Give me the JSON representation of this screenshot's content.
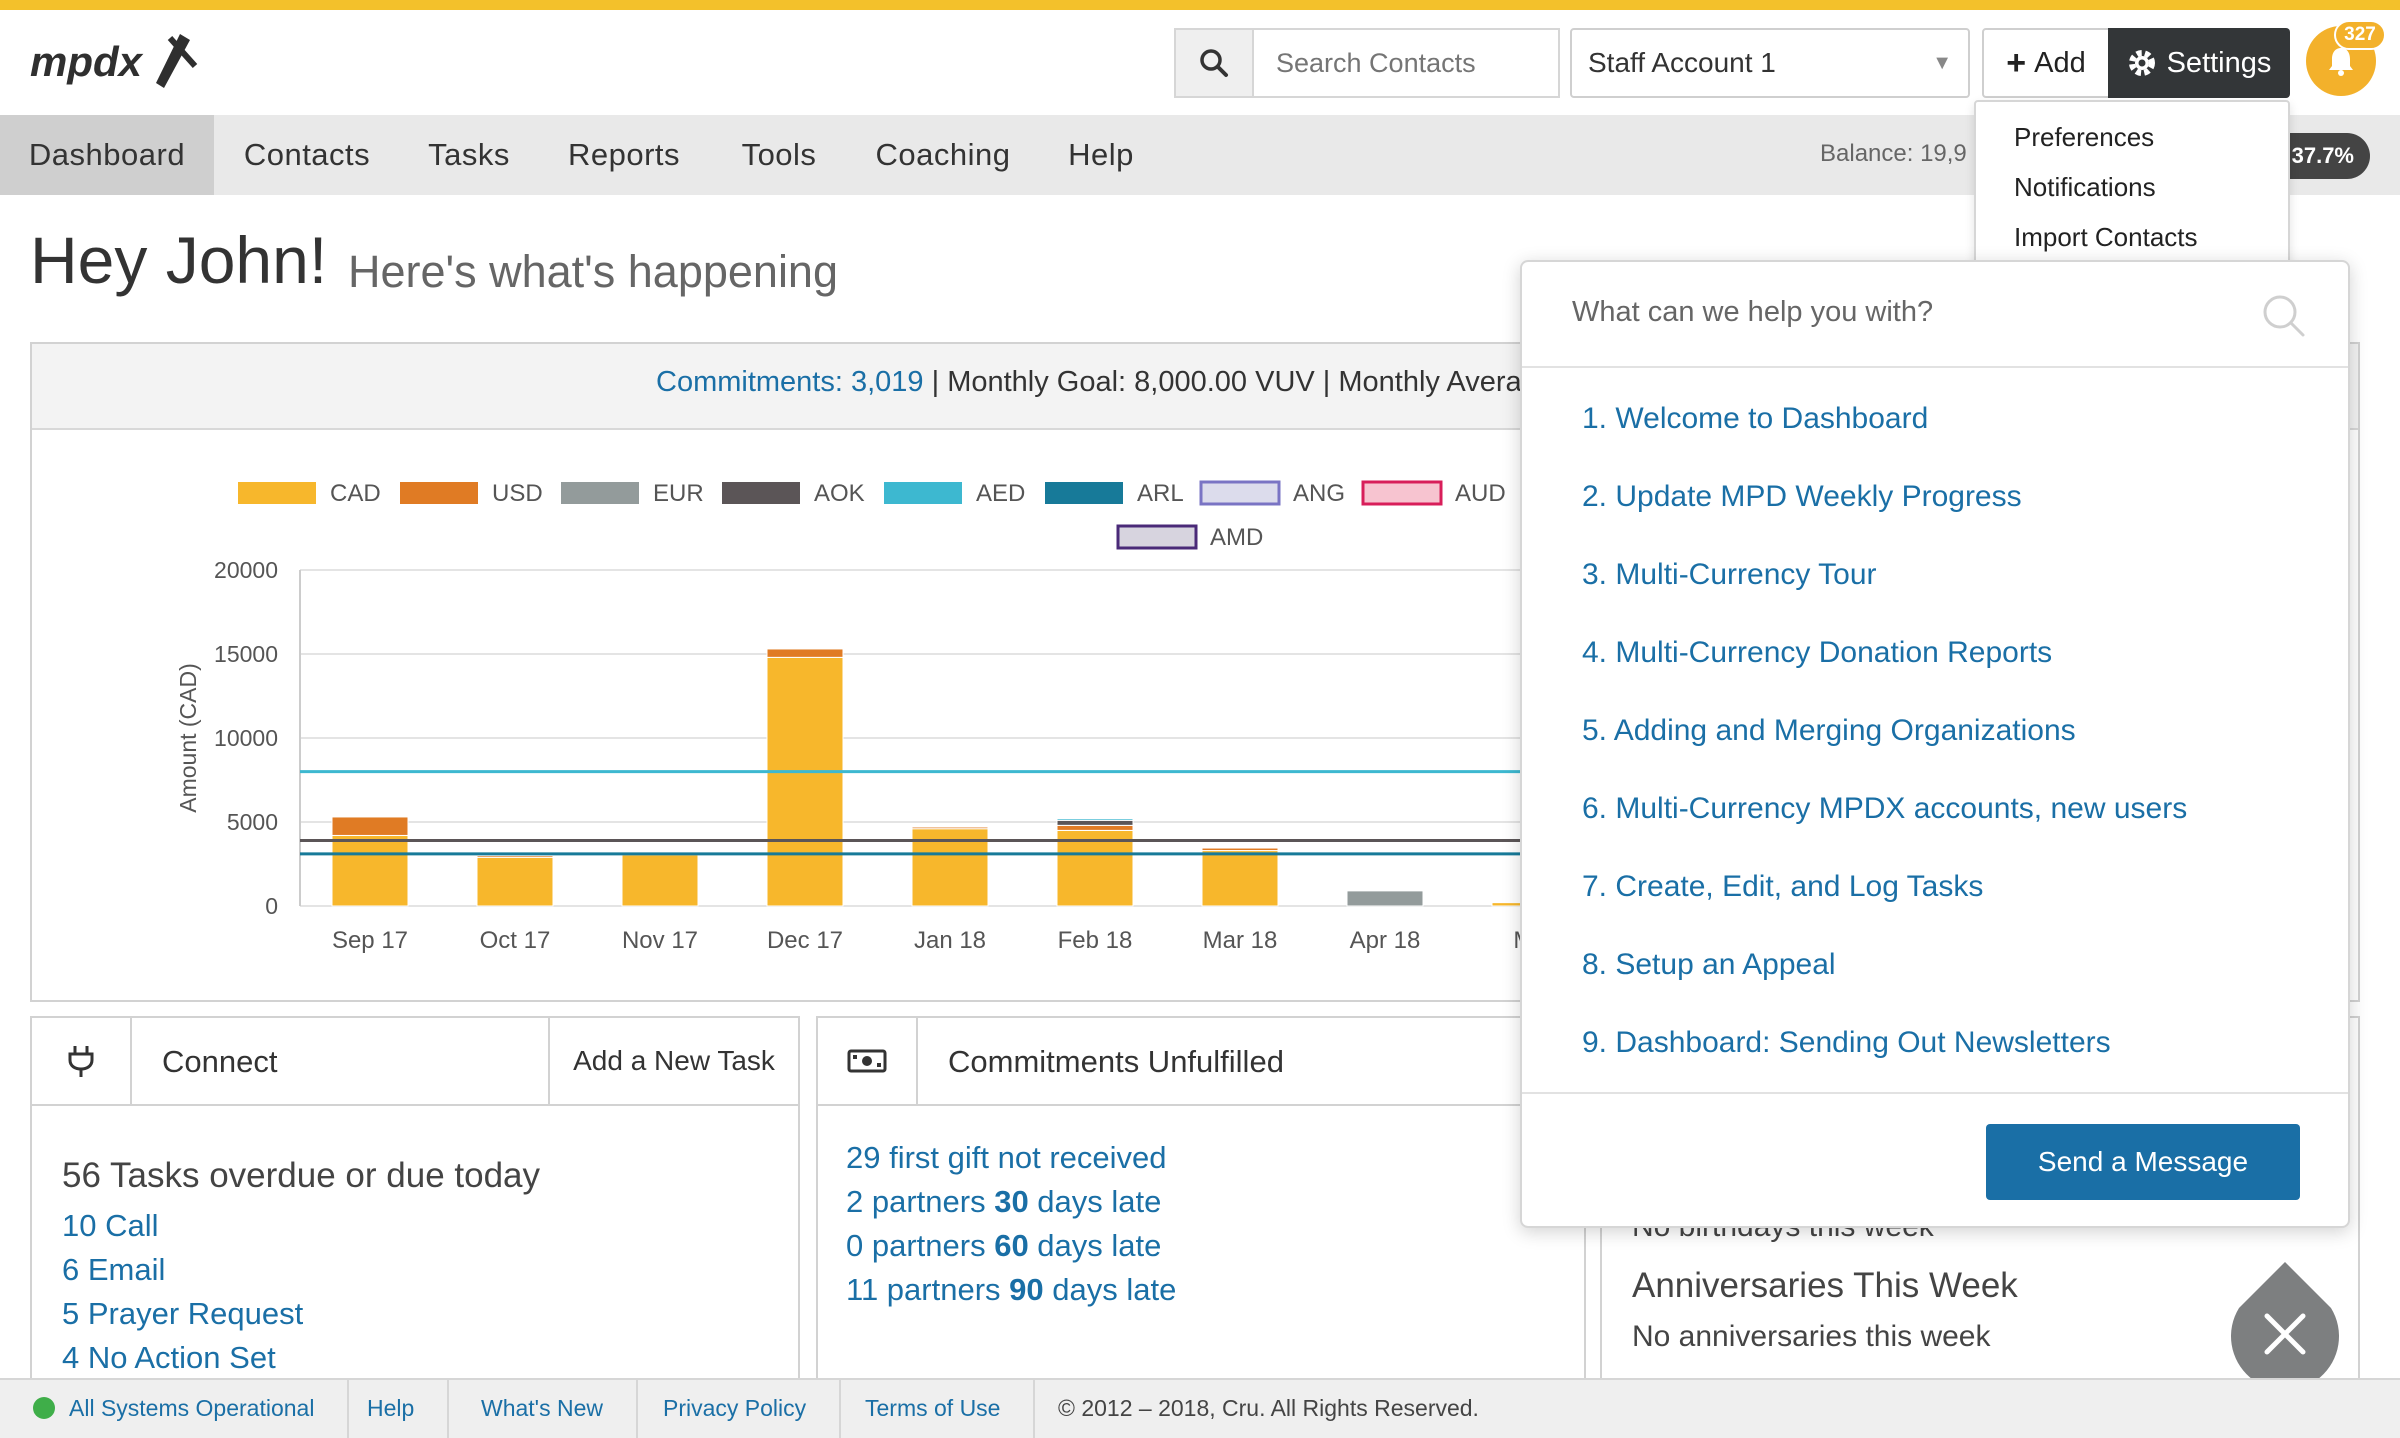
{
  "brand": {
    "logo_text": "mpdx",
    "accent_color": "#f3c12b",
    "link_color": "#1a6fa6"
  },
  "header": {
    "search_placeholder": "Search Contacts",
    "account_select": "Staff Account 1",
    "add_label": "Add",
    "settings_label": "Settings",
    "notification_count": "327"
  },
  "nav": {
    "items": [
      "Dashboard",
      "Contacts",
      "Tasks",
      "Reports",
      "Tools",
      "Coaching",
      "Help"
    ],
    "active": "Dashboard",
    "balance": "Balance: 19,9",
    "percent": "37.7%"
  },
  "settings_menu": {
    "items": [
      "Preferences",
      "Notifications",
      "Import Contacts"
    ]
  },
  "greeting": {
    "title": "Hey John!",
    "subtitle": "Here's what's happening"
  },
  "commitments_bar": {
    "commitments_link": "Commitments: 3,019",
    "rest": " | Monthly Goal: 8,000.00 VUV | Monthly Avera"
  },
  "chart_data": {
    "type": "bar",
    "stacked": true,
    "ylabel": "Amount (CAD)",
    "ylim": [
      0,
      20000
    ],
    "yticks": [
      0,
      5000,
      10000,
      15000,
      20000
    ],
    "categories": [
      "Sep 17",
      "Oct 17",
      "Nov 17",
      "Dec 17",
      "Jan 18",
      "Feb 18",
      "Mar 18",
      "Apr 18",
      "Ma"
    ],
    "legend": [
      {
        "name": "CAD",
        "color": "#f7b72c"
      },
      {
        "name": "USD",
        "color": "#e07b24"
      },
      {
        "name": "EUR",
        "color": "#939b9b"
      },
      {
        "name": "AOK",
        "color": "#5b5557"
      },
      {
        "name": "AED",
        "color": "#3db8d0"
      },
      {
        "name": "ARL",
        "color": "#177a99"
      },
      {
        "name": "ANG",
        "color": "#dcdcec",
        "border": "#7a74c4"
      },
      {
        "name": "AUD",
        "color": "#f7c4d0",
        "border": "#d81e5a"
      },
      {
        "name": "AMD",
        "color": "#d7d4df",
        "border": "#4a2a78"
      }
    ],
    "series": [
      {
        "name": "CAD",
        "values": [
          4200,
          2900,
          3050,
          14800,
          4600,
          4500,
          3300,
          0,
          200
        ]
      },
      {
        "name": "USD",
        "values": [
          1100,
          100,
          50,
          500,
          100,
          300,
          150,
          0,
          0
        ]
      },
      {
        "name": "EUR",
        "values": [
          0,
          0,
          0,
          0,
          0,
          0,
          0,
          900,
          0
        ]
      },
      {
        "name": "AOK",
        "values": [
          0,
          0,
          0,
          0,
          0,
          300,
          0,
          0,
          0
        ]
      },
      {
        "name": "AED",
        "values": [
          0,
          0,
          0,
          0,
          0,
          100,
          0,
          0,
          0
        ]
      }
    ],
    "reference_lines": [
      {
        "value": 8000,
        "color": "#3db8d0"
      },
      {
        "value": 3900,
        "color": "#5b5557"
      },
      {
        "value": 3100,
        "color": "#177a99"
      }
    ]
  },
  "connect": {
    "title": "Connect",
    "action": "Add a New Task",
    "summary": "56 Tasks overdue or due today",
    "links": [
      "10 Call",
      "6 Email",
      "5 Prayer Request",
      "4 No Action Set"
    ]
  },
  "commitments_unfulfilled": {
    "title": "Commitments Unfulfilled",
    "lines": [
      {
        "pre": "29 first gift not received",
        "bold": "",
        "post": ""
      },
      {
        "pre": "2 partners ",
        "bold": "30",
        "post": " days late"
      },
      {
        "pre": "0 partners ",
        "bold": "60",
        "post": " days late"
      },
      {
        "pre": "11 partners ",
        "bold": "90",
        "post": " days late"
      }
    ]
  },
  "celebrations": {
    "birthdays_text": "No birthdays this week",
    "anniversaries_title": "Anniversaries This Week",
    "anniversaries_text": "No anniversaries this week"
  },
  "help_popup": {
    "search_placeholder": "What can we help you with?",
    "items": [
      "1. Welcome to Dashboard",
      "2. Update MPD Weekly Progress",
      "3. Multi-Currency Tour",
      "4. Multi-Currency Donation Reports",
      "5. Adding and Merging Organizations",
      "6. Multi-Currency MPDX accounts, new users",
      "7. Create, Edit, and Log Tasks",
      "8. Setup an Appeal",
      "9. Dashboard: Sending Out Newsletters"
    ],
    "send_label": "Send a Message"
  },
  "footer": {
    "status": "All Systems Operational",
    "status_color": "#3fae49",
    "links": [
      "Help",
      "What's New",
      "Privacy Policy",
      "Terms of Use"
    ],
    "copyright": "© 2012 – 2018, Cru. All Rights Reserved."
  }
}
